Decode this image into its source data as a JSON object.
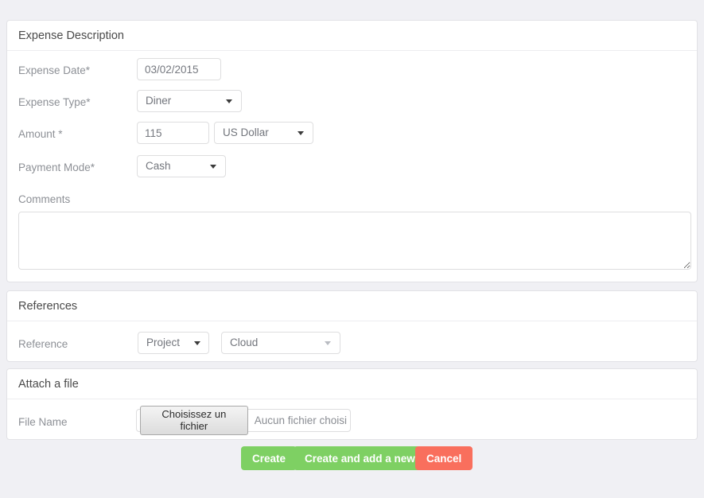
{
  "theme": {
    "page_background": "#f0f0f4",
    "panel_background": "#ffffff",
    "panel_border": "#e2e2e6",
    "label_color": "#8d9096",
    "header_color": "#4a4a4a",
    "primary_button_color": "#7ed063",
    "danger_button_color": "#f96f5d"
  },
  "sections": {
    "expense": {
      "title": "Expense Description",
      "fields": {
        "expense_date": {
          "label": "Expense Date*",
          "value": "03/02/2015",
          "placeholder": ""
        },
        "expense_type": {
          "label": "Expense Type*",
          "value": "Diner"
        },
        "amount": {
          "label": "Amount *",
          "value": "115",
          "placeholder": ""
        },
        "currency": {
          "value": "US Dollar"
        },
        "payment_mode": {
          "label": "Payment Mode*",
          "value": "Cash"
        },
        "comments": {
          "label": "Comments",
          "value": "",
          "placeholder": ""
        }
      }
    },
    "references": {
      "title": "References",
      "fields": {
        "reference": {
          "label": "Reference",
          "type_value": "Project",
          "target_value": "Cloud"
        }
      }
    },
    "attachment": {
      "title": "Attach a file",
      "fields": {
        "file_name": {
          "label": "File Name",
          "button_label": "Choisissez un fichier",
          "status_text": "Aucun fichier choisi"
        }
      }
    }
  },
  "actions": {
    "create": "Create",
    "create_and_add": "Create and add a new",
    "cancel": "Cancel"
  },
  "icons": {
    "dropdown_arrow": "chevron-down-icon"
  }
}
